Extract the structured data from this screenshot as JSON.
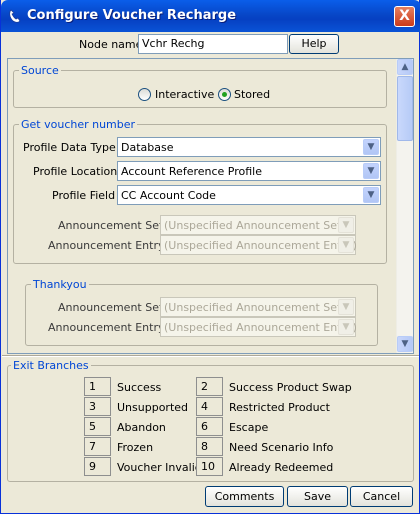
{
  "window": {
    "title": "Configure Voucher Recharge",
    "close_glyph": "X"
  },
  "node_name": {
    "label": "Node name",
    "value": "Vchr Rechg",
    "help_label": "Help"
  },
  "source": {
    "title": "Source",
    "options": [
      {
        "label": "Interactive",
        "selected": false
      },
      {
        "label": "Stored",
        "selected": true
      }
    ]
  },
  "get_voucher": {
    "title": "Get voucher number",
    "profile_data_type": {
      "label": "Profile Data Type",
      "value": "Database"
    },
    "profile_location": {
      "label": "Profile Location",
      "value": "Account Reference Profile"
    },
    "profile_field": {
      "label": "Profile Field",
      "value": "CC Account Code"
    },
    "announcement_set": {
      "label": "Announcement Set",
      "value": "(Unspecified Announcement Set)"
    },
    "announcement_entry": {
      "label": "Announcement Entry",
      "value": "(Unspecified Announcement Entry)"
    }
  },
  "thankyou": {
    "title": "Thankyou",
    "announcement_set": {
      "label": "Announcement Set",
      "value": "(Unspecified Announcement Set)"
    },
    "announcement_entry": {
      "label": "Announcement Entry",
      "value": "(Unspecified Announcement Entry)"
    }
  },
  "exit_branches": {
    "title": "Exit Branches",
    "left": [
      {
        "num": "1",
        "label": "Success"
      },
      {
        "num": "3",
        "label": "Unsupported"
      },
      {
        "num": "5",
        "label": "Abandon"
      },
      {
        "num": "7",
        "label": "Frozen"
      },
      {
        "num": "9",
        "label": "Voucher Invalid"
      }
    ],
    "right": [
      {
        "num": "2",
        "label": "Success Product Swap"
      },
      {
        "num": "4",
        "label": "Restricted Product"
      },
      {
        "num": "6",
        "label": "Escape"
      },
      {
        "num": "8",
        "label": "Need Scenario Info"
      },
      {
        "num": "10",
        "label": "Already Redeemed"
      }
    ]
  },
  "buttons": {
    "comments": "Comments",
    "save": "Save",
    "cancel": "Cancel"
  },
  "icons": {
    "title": "phone-handset-icon",
    "combo_arrow": "chevron-down-icon",
    "scroll_up": "scroll-up-icon",
    "scroll_down": "scroll-down-icon"
  },
  "colors": {
    "titlebar": "#0A5EEA",
    "group_title": "#0046D5",
    "face": "#ECE9D8"
  }
}
